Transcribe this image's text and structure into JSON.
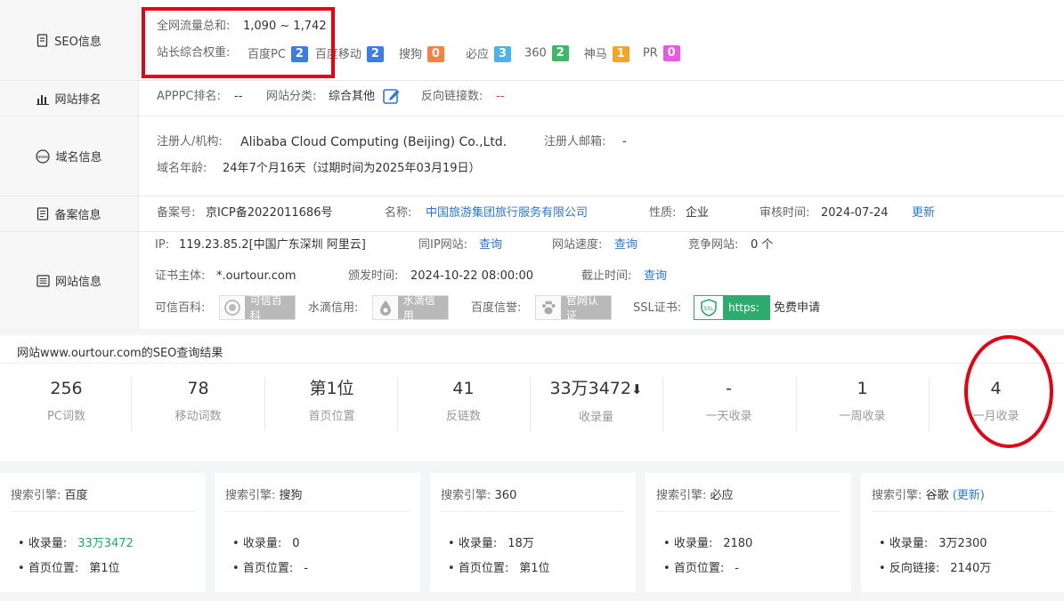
{
  "seo": {
    "label": "SEO信息",
    "traffic_label": "全网流量总和:",
    "traffic_value": "1,090 ~ 1,742",
    "weight_label": "站长综合权重:",
    "weights": [
      {
        "name": "百度PC",
        "value": "2",
        "color": "#3b7de8"
      },
      {
        "name": "百度移动",
        "value": "2",
        "color": "#3b7de8"
      },
      {
        "name": "搜狗",
        "value": "0",
        "color": "#f97f42"
      },
      {
        "name": "必应",
        "value": "3",
        "color": "#4cb4ec"
      },
      {
        "name": "360",
        "value": "2",
        "color": "#3fb866"
      },
      {
        "name": "神马",
        "value": "1",
        "color": "#f3a623"
      },
      {
        "name": "PR",
        "value": "0",
        "color": "#e859e6"
      }
    ]
  },
  "rank": {
    "label": "网站排名",
    "apppc_label": "APPPC排名:",
    "apppc_value": "--",
    "category_label": "网站分类:",
    "category_value": "综合其他",
    "backlink_label": "反向链接数:",
    "backlink_value": "--"
  },
  "domain": {
    "label": "域名信息",
    "registrant_label": "注册人/机构:",
    "registrant_value": "Alibaba Cloud Computing (Beijing) Co.,Ltd.",
    "email_label": "注册人邮箱:",
    "email_value": "-",
    "age_label": "域名年龄:",
    "age_value": "24年7个月16天（过期时间为2025年03月19日）"
  },
  "icp": {
    "label": "备案信息",
    "no_label": "备案号:",
    "no_value": "京ICP备2022011686号",
    "name_label": "名称:",
    "name_value": "中国旅游集团旅行服务有限公司",
    "nature_label": "性质:",
    "nature_value": "企业",
    "audit_label": "审核时间:",
    "audit_value": "2024-07-24",
    "update_link": "更新"
  },
  "site": {
    "label": "网站信息",
    "ip_label": "IP:",
    "ip_value": "119.23.85.2[中国广东深圳 阿里云]",
    "same_ip_label": "同IP网站:",
    "query": "查询",
    "speed_label": "网站速度:",
    "compete_label": "竞争网站:",
    "compete_value": "0 个",
    "cert_label": "证书主体:",
    "cert_value": "*.ourtour.com",
    "issue_label": "颁发时间:",
    "issue_value": "2024-10-22 08:00:00",
    "expire_label": "截止时间:",
    "kexin_label": "可信百科:",
    "kexin_chip": "可信百科",
    "shuidi_label": "水滴信用:",
    "shuidi_chip": "水滴信用",
    "baidu_label": "百度信誉:",
    "baidu_chip": "官网认证",
    "ssl_label": "SSL证书:",
    "ssl_ic": "SSL",
    "ssl_chip": "https:",
    "ssl_free": "免费申请"
  },
  "result": {
    "title": "网站www.ourtour.com的SEO查询结果",
    "stats": [
      {
        "value": "256",
        "key": "PC词数"
      },
      {
        "value": "78",
        "key": "移动词数"
      },
      {
        "value": "第1位",
        "key": "首页位置"
      },
      {
        "value": "41",
        "key": "反链数"
      },
      {
        "value": "33万3472",
        "key": "收录量",
        "arrow": "⬇"
      },
      {
        "value": "-",
        "key": "一天收录"
      },
      {
        "value": "1",
        "key": "一周收录"
      },
      {
        "value": "4",
        "key": "一月收录"
      }
    ]
  },
  "engines": [
    {
      "label": "搜索引擎:",
      "name": "百度",
      "extra": "",
      "l1": "收录量:",
      "v1": "33万3472",
      "l2": "首页位置:",
      "v2": "第1位"
    },
    {
      "label": "搜索引擎:",
      "name": "搜狗",
      "extra": "",
      "l1": "收录量:",
      "v1": "0",
      "l2": "首页位置:",
      "v2": "-"
    },
    {
      "label": "搜索引擎:",
      "name": "360",
      "extra": "",
      "l1": "收录量:",
      "v1": "18万",
      "l2": "首页位置:",
      "v2": "第1位"
    },
    {
      "label": "搜索引擎:",
      "name": "必应",
      "extra": "",
      "l1": "收录量:",
      "v1": "2180",
      "l2": "首页位置:",
      "v2": "-"
    },
    {
      "label": "搜索引擎:",
      "name": "谷歌",
      "extra": "(更新)",
      "l1": "收录量:",
      "v1": "3万2300",
      "l2": "反向链接:",
      "v2": "2140万"
    }
  ],
  "colors": {
    "highlight": "#e60012",
    "link": "#2a78d1",
    "green": "#1aab6b"
  }
}
